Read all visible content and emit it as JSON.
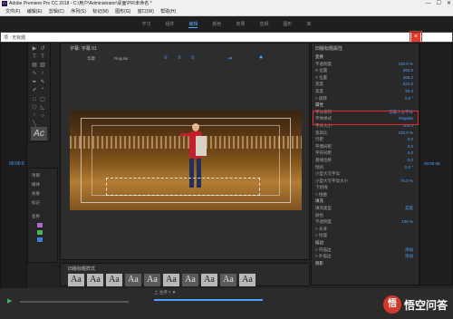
{
  "window": {
    "title": "Adobe Premiere Pro CC 2018 - C:\\用户\\Administrator\\桌面\\PR\\未命名 *",
    "logo_text": "Pr",
    "minimize": "—",
    "maximize": "☐",
    "close": "✕"
  },
  "menu": [
    "文件(F)",
    "编辑(E)",
    "剪辑(C)",
    "序列(S)",
    "标记(M)",
    "图形(G)",
    "窗口(W)",
    "帮助(H)"
  ],
  "workspaces": [
    "学习",
    "组件",
    "编辑",
    "颜色",
    "效果",
    "音频",
    "图形",
    "库"
  ],
  "doc_tab": {
    "label": "项 : 无标题"
  },
  "close_button": "×",
  "essential_panel_title": "字幕: 字幕 01",
  "text_tools": {
    "font": "华康",
    "style": "Regular"
  },
  "graphic_panel": {
    "title": "旧版标题属性",
    "sections": [
      {
        "label": "变换",
        "type": "section"
      },
      {
        "label": "不透明度",
        "value": "100.0 %"
      },
      {
        "label": "X 位置",
        "value": "293.0"
      },
      {
        "label": "Y 位置",
        "value": "265.2"
      },
      {
        "label": "宽度",
        "value": "521.0"
      },
      {
        "label": "高度",
        "value": "93.3"
      },
      {
        "label": "> 旋转",
        "value": "0.0 °"
      },
      {
        "label": "属性",
        "type": "section"
      },
      {
        "label": "字体系列",
        "value": "华康少女字体"
      },
      {
        "label": "字体样式",
        "value": "Regular"
      },
      {
        "label": "字体大小",
        "value": "100.0"
      },
      {
        "label": "宽高比",
        "value": "100.0 %"
      },
      {
        "label": "行距",
        "value": "0.0"
      },
      {
        "label": "字偶间距",
        "value": "0.0"
      },
      {
        "label": "字符间距",
        "value": "0.0"
      },
      {
        "label": "基线位移",
        "value": "0.0"
      },
      {
        "label": "倾斜",
        "value": "0.0 °"
      },
      {
        "label": "小型大写字母",
        "value": ""
      },
      {
        "label": "小型大写字母大小",
        "value": "75.0 %"
      },
      {
        "label": "下划线",
        "value": ""
      },
      {
        "label": "> 扭曲",
        "value": ""
      },
      {
        "label": "填充",
        "type": "section"
      },
      {
        "label": "填充类型",
        "value": "实底"
      },
      {
        "label": "颜色",
        "value": ""
      },
      {
        "label": "不透明度",
        "value": "100 %"
      },
      {
        "label": "> 光泽",
        "value": ""
      },
      {
        "label": "> 纹理",
        "value": ""
      },
      {
        "label": "描边",
        "type": "section"
      },
      {
        "label": "> 内描边",
        "value": "添加"
      },
      {
        "label": "> 外描边",
        "value": "添加"
      },
      {
        "label": "阴影",
        "type": "section"
      }
    ]
  },
  "styles_panel_title": "旧版标题样式",
  "styles": [
    "Aa",
    "Aa",
    "Aa",
    "Aa",
    "Aa",
    "Aa",
    "Aa",
    "Aa",
    "Aa",
    "Aa"
  ],
  "timecode_left": "00:00:0",
  "timecode_right": "00:06:06",
  "project_labels": [
    "项目",
    "媒体",
    "效果",
    "标记",
    "名称"
  ],
  "timeline_label": "上 主序 7 ▼",
  "watermark": {
    "icon": "悟",
    "text": "悟空问答"
  },
  "colors": {
    "accent": "#4aa3ff",
    "close_red": "#e23b2a",
    "highlight_red": "#e32c2c"
  }
}
